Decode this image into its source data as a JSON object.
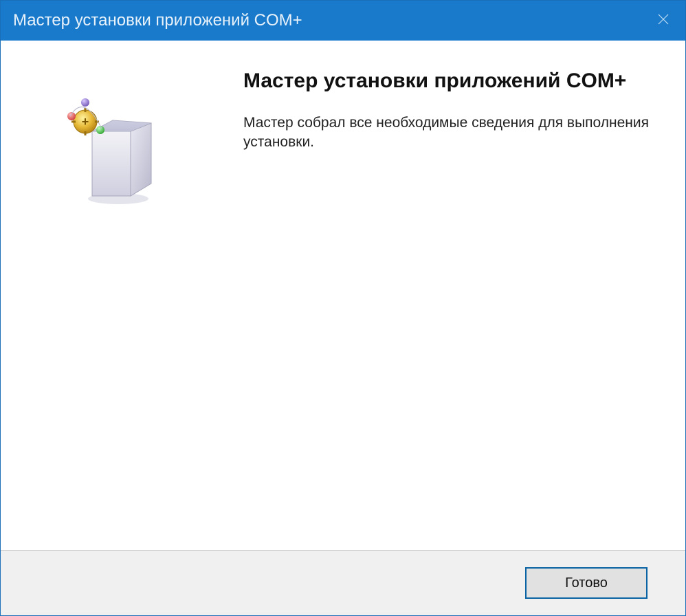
{
  "window": {
    "title": "Мастер установки приложений COM+"
  },
  "main": {
    "heading": "Мастер установки приложений COM+",
    "description": "Мастер собрал все необходимые сведения для выполнения установки."
  },
  "footer": {
    "finish_label": "Готово"
  },
  "icons": {
    "close": "close-icon",
    "wizard": "installer-box-icon"
  }
}
